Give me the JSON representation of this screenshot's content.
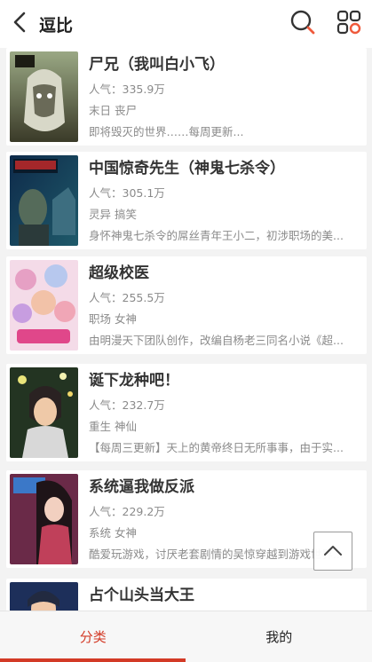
{
  "header": {
    "title": "逗比",
    "back_icon": "chevron-left-icon",
    "search_icon": "search-icon",
    "menu_icon": "grid-menu-icon"
  },
  "comics": [
    {
      "name": "尸兄（我叫白小飞）",
      "popularity": "人气：335.9万",
      "tags": "末日 丧尸",
      "desc": "即将毁灭的世界……每周更新..."
    },
    {
      "name": "中国惊奇先生（神鬼七杀令）",
      "popularity": "人气：305.1万",
      "tags": "灵异 搞笑",
      "desc": "身怀神鬼七杀令的屌丝青年王小二，初涉职场的美..."
    },
    {
      "name": "超级校医",
      "popularity": "人气：255.5万",
      "tags": "职场 女神",
      "desc": "由明漫天下团队创作，改编自杨老三同名小说《超..."
    },
    {
      "name": "诞下龙种吧！",
      "popularity": "人气：232.7万",
      "tags": "重生 神仙",
      "desc": "【每周三更新】天上的黄帝终日无所事事，由于实..."
    },
    {
      "name": "系统逼我做反派",
      "popularity": "人气：229.2万",
      "tags": "系统 女神",
      "desc": "酷爱玩游戏，讨厌老套剧情的吴惊穿越到游戏世界..."
    },
    {
      "name": "占个山头当大王",
      "popularity": "",
      "tags": "",
      "desc": ""
    }
  ],
  "tabs": [
    {
      "label": "分类",
      "active": true
    },
    {
      "label": "我的",
      "active": false
    }
  ],
  "colors": {
    "accent": "#d33a26",
    "search_accent": "#ef5a3c"
  }
}
